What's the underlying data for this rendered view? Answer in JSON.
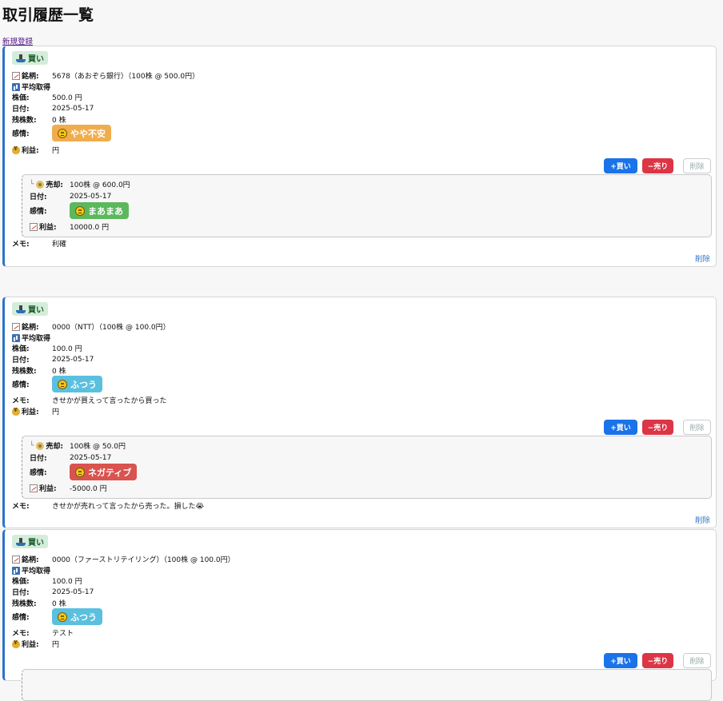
{
  "page": {
    "title": "取引履歴一覧",
    "new_link": "新規登録"
  },
  "labels": {
    "stock": "銘柄:",
    "avg": "平均取得",
    "price": "株価:",
    "date": "日付:",
    "remain": "残株数:",
    "emotion": "感情:",
    "memo": "メモ:",
    "profit": "利益:",
    "sell": "売却:",
    "buy_btn": "+買い",
    "sell_btn": "−売り",
    "delete": "削除"
  },
  "trades": [
    {
      "kind": "買い",
      "stock": "5678（あおぞら銀行）（100株 @ 500.0円）",
      "price": "500.0 円",
      "date": "2025-05-17",
      "remain": "0 株",
      "emotion": {
        "text": "やや不安",
        "color": "#f0ad4e"
      },
      "memo": "",
      "profit": "円",
      "sale": {
        "sell": "100株 @ 600.0円",
        "date": "2025-05-17",
        "emotion": {
          "text": "まあまあ",
          "color": "#5cb85c"
        },
        "profit": "10000.0 円"
      },
      "sale_memo": "利確"
    },
    {
      "kind": "買い",
      "stock": "0000（NTT）（100株 @ 100.0円）",
      "price": "100.0 円",
      "date": "2025-05-17",
      "remain": "0 株",
      "emotion": {
        "text": "ふつう",
        "color": "#5bc0de"
      },
      "memo": "きせかが買えって言ったから買った",
      "profit": "円",
      "sale": {
        "sell": "100株 @ 50.0円",
        "date": "2025-05-17",
        "emotion": {
          "text": "ネガティブ",
          "color": "#d9534f"
        },
        "profit": "-5000.0 円"
      },
      "sale_memo": "きせかが売れって言ったから売った。損した😭"
    },
    {
      "kind": "買い",
      "stock": "0000（ファーストリテイリング）（100株 @ 100.0円）",
      "price": "100.0 円",
      "date": "2025-05-17",
      "remain": "0 株",
      "emotion": {
        "text": "ふつう",
        "color": "#5bc0de"
      },
      "memo": "テスト",
      "profit": "円"
    }
  ]
}
